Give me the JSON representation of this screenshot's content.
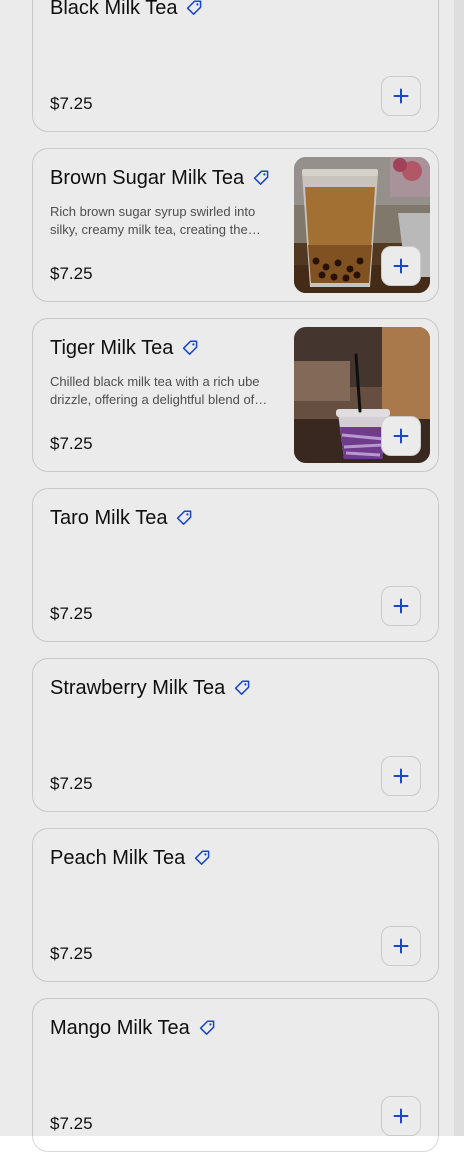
{
  "colors": {
    "accent": "#1d4ed8",
    "card_border": "#d9d9d9",
    "overlay": "#000000"
  },
  "icons": {
    "tag": "tag-icon",
    "add": "plus-icon"
  },
  "menu": {
    "items": [
      {
        "name": "Black Milk Tea",
        "description": "",
        "price": "$7.25",
        "has_photo": false
      },
      {
        "name": "Brown Sugar Milk Tea",
        "description": "Rich brown sugar syrup swirled into silky, creamy milk tea, creating the…",
        "price": "$7.25",
        "has_photo": true
      },
      {
        "name": "Tiger Milk Tea",
        "description": "Chilled black milk tea with a rich ube drizzle, offering a delightful blend of…",
        "price": "$7.25",
        "has_photo": true
      },
      {
        "name": "Taro Milk Tea",
        "description": "",
        "price": "$7.25",
        "has_photo": false
      },
      {
        "name": "Strawberry Milk Tea",
        "description": "",
        "price": "$7.25",
        "has_photo": false
      },
      {
        "name": "Peach Milk Tea",
        "description": "",
        "price": "$7.25",
        "has_photo": false
      },
      {
        "name": "Mango Milk Tea",
        "description": "",
        "price": "$7.25",
        "has_photo": false
      }
    ]
  }
}
